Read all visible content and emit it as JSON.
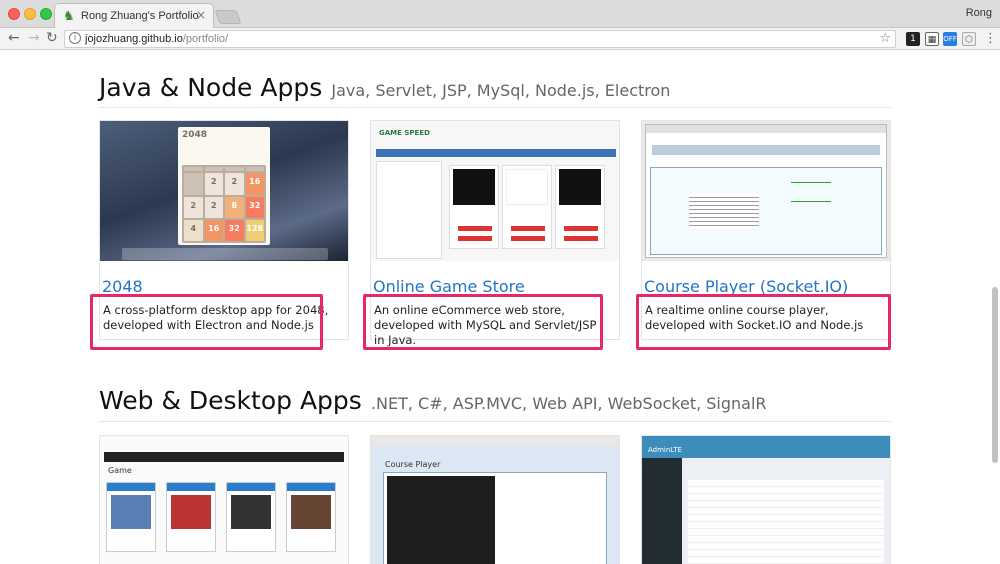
{
  "browser": {
    "tab_title": "Rong Zhuang's Portfolio",
    "tab_close": "×",
    "profile_name": "Rong",
    "url_host": "jojozhuang.github.io",
    "url_path": "/portfolio/",
    "ext_badge": "1",
    "ext_off": "OFF"
  },
  "sections": [
    {
      "title": "Java & Node Apps",
      "subtitle": "Java, Servlet, JSP, MySql, Node.js, Electron",
      "cards": [
        {
          "title": "2048",
          "description": "A cross-platform desktop app for 2048, developed with Electron and Node.js",
          "thumb_text": "2048"
        },
        {
          "title": "Online Game Store",
          "description": "An online eCommerce web store, developed with MySQL and Servlet/JSP in Java.",
          "thumb_text": "GAME SPEED"
        },
        {
          "title": "Course Player (Socket.IO)",
          "description": "A realtime online course player, developed with Socket.IO and Node.js"
        }
      ]
    },
    {
      "title": "Web & Desktop Apps",
      "subtitle": ".NET, C#, ASP.MVC, Web API, WebSocket, SignalR",
      "cards": [
        {
          "thumb_text": "Game"
        },
        {
          "thumb_text": "Course Player"
        },
        {
          "thumb_text": "AdminLTE"
        }
      ]
    }
  ],
  "game2048_tiles": [
    "",
    "",
    "",
    "",
    "",
    "",
    "",
    "",
    "",
    "2",
    "2",
    "16",
    "2",
    "2",
    "8",
    "32",
    "4",
    "16",
    "32",
    "128"
  ],
  "colors": {
    "highlight": "#e6286a",
    "link": "#2574c5"
  }
}
